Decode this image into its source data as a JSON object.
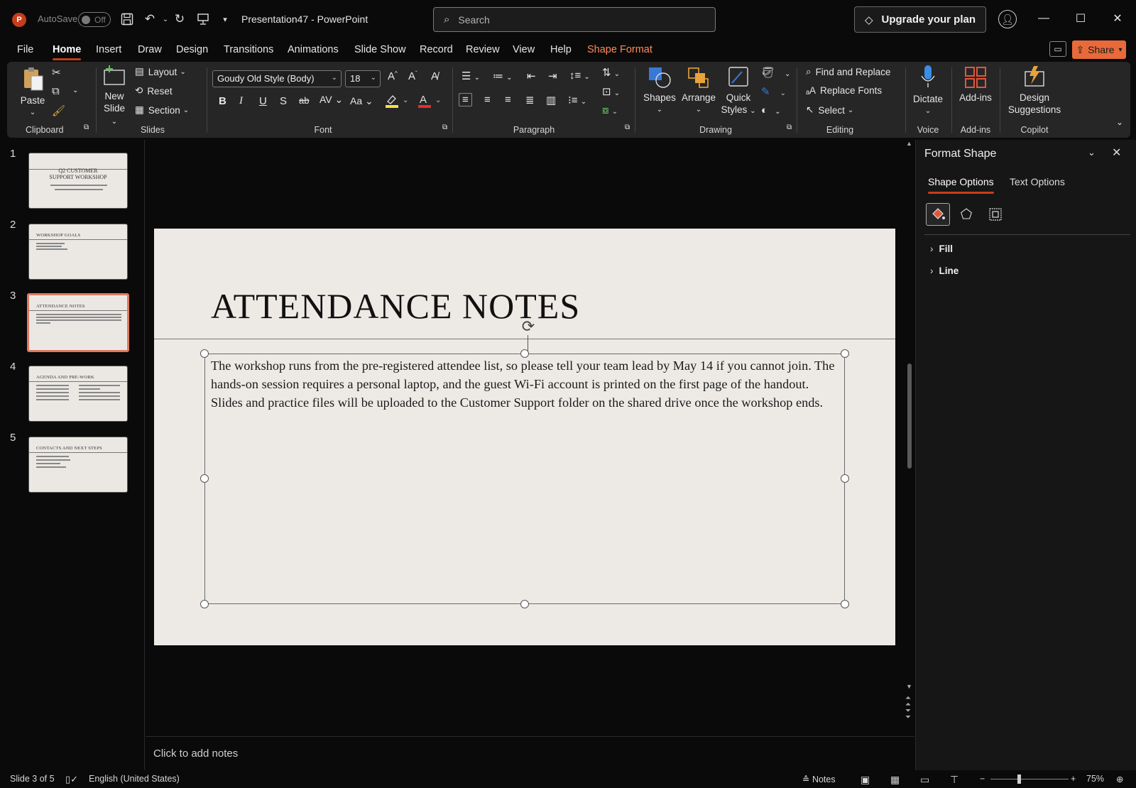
{
  "titlebar": {
    "autosave_label": "AutoSave",
    "autosave_state": "Off",
    "document_title": "Presentation47  -  PowerPoint",
    "search_placeholder": "Search",
    "upgrade_label": "Upgrade your plan",
    "app_logo_letter": "P"
  },
  "menu": {
    "tabs": [
      "File",
      "Home",
      "Insert",
      "Draw",
      "Design",
      "Transitions",
      "Animations",
      "Slide Show",
      "Record",
      "Review",
      "View",
      "Help",
      "Shape Format"
    ],
    "active_tab": "Home",
    "share_label": "Share"
  },
  "ribbon": {
    "clipboard": {
      "label": "Clipboard",
      "paste": "Paste"
    },
    "slides": {
      "label": "Slides",
      "new_slide": "New",
      "new_slide_2": "Slide",
      "layout": "Layout",
      "reset": "Reset",
      "section": "Section"
    },
    "font": {
      "label": "Font",
      "font_name": "Goudy Old Style (Body)",
      "font_size": "18"
    },
    "paragraph": {
      "label": "Paragraph"
    },
    "drawing": {
      "label": "Drawing",
      "shapes": "Shapes",
      "arrange": "Arrange",
      "quick_styles_1": "Quick",
      "quick_styles_2": "Styles"
    },
    "editing": {
      "label": "Editing",
      "find_replace": "Find and Replace",
      "replace_fonts": "Replace Fonts",
      "select": "Select"
    },
    "voice": {
      "label": "Voice",
      "dictate": "Dictate"
    },
    "addins": {
      "label": "Add-ins",
      "addins_btn": "Add-ins"
    },
    "copilot": {
      "label": "Copilot",
      "design_1": "Design",
      "design_2": "Suggestions"
    }
  },
  "thumbnails": [
    {
      "num": "1",
      "title_1": "Q2 CUSTOMER",
      "title_2": "SUPPORT WORKSHOP"
    },
    {
      "num": "2",
      "title": "WORKSHOP GOALS"
    },
    {
      "num": "3",
      "title": "ATTENDANCE NOTES"
    },
    {
      "num": "4",
      "title": "AGENDA AND PRE-WORK"
    },
    {
      "num": "5",
      "title": "CONTACTS AND NEXT STEPS"
    }
  ],
  "slide": {
    "title": "ATTENDANCE NOTES",
    "body": "The workshop runs from the pre-registered attendee list, so please tell your team lead by May 14 if you cannot join. The hands-on session requires a personal laptop, and the guest Wi-Fi account is printed on the first page of the handout. Slides and practice files will be uploaded to the Customer Support folder on the shared drive once the workshop ends."
  },
  "notes_placeholder": "Click to add notes",
  "format_pane": {
    "title": "Format Shape",
    "tab_shape": "Shape Options",
    "tab_text": "Text Options",
    "section_fill": "Fill",
    "section_line": "Line"
  },
  "status": {
    "slide_pos": "Slide 3 of 5",
    "language": "English (United States)",
    "notes": "Notes",
    "zoom": "75%",
    "zoom_fraction": 0.36
  },
  "colors": {
    "accent": "#c43e1c",
    "shape_format": "#ff8a5b",
    "share": "#e86a3a",
    "selected_thumb": "#e07a63"
  }
}
